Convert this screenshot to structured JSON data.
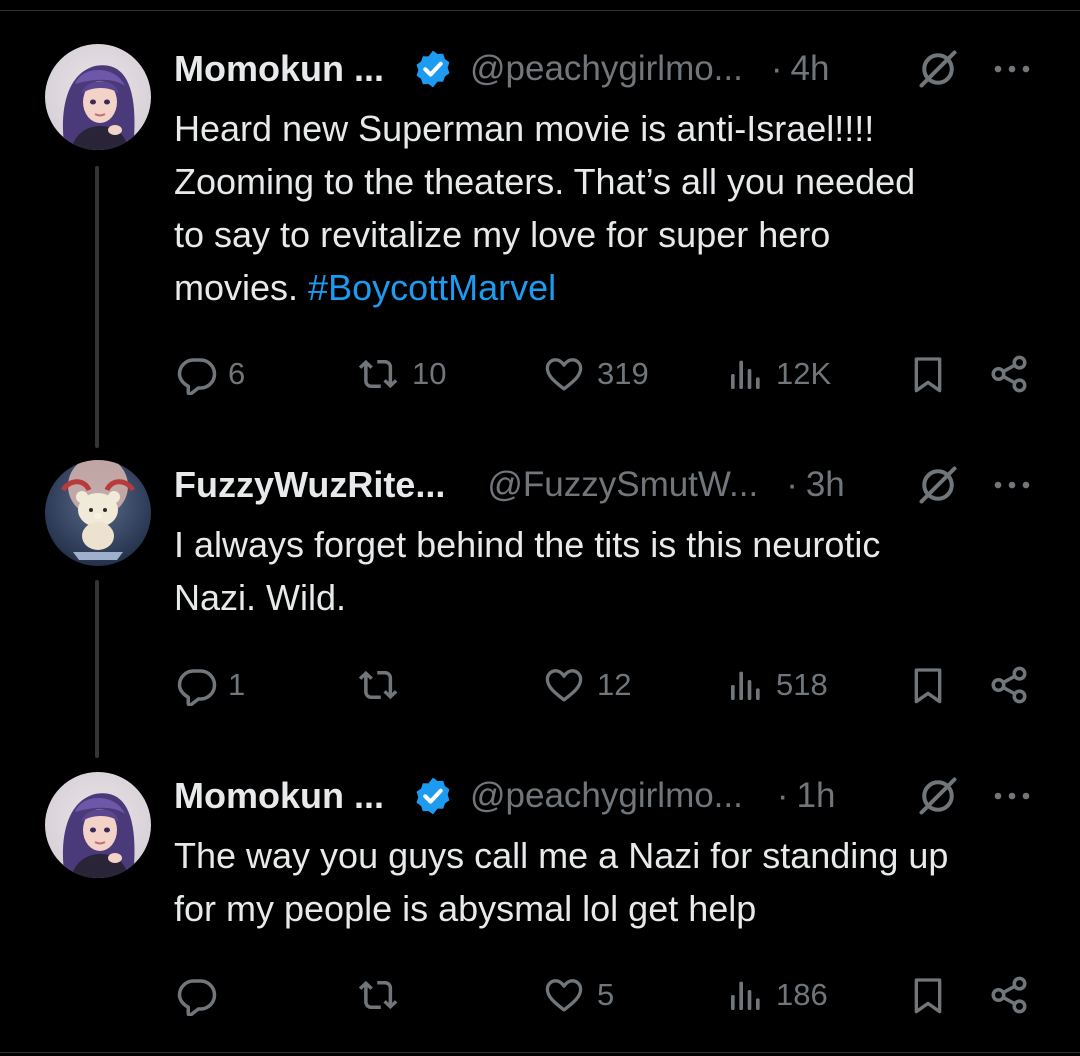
{
  "tweets": [
    {
      "name": "Momokun ...",
      "verified": true,
      "handle": "@peachygirlmo...",
      "separator": "·",
      "time": "4h",
      "text": "Heard new Superman movie is anti-Israel!!!!\nZooming to the theaters. That’s all you needed\nto say to revitalize my love for super hero\nmovies. ",
      "hashtag": "#BoycottMarvel",
      "stats": {
        "replies": "6",
        "reposts": "10",
        "likes": "319",
        "views": "12K"
      }
    },
    {
      "name": "FuzzyWuzRite...",
      "verified": false,
      "handle": "@FuzzySmutW...",
      "separator": "·",
      "time": "3h",
      "text": "I always forget behind the tits is this neurotic\nNazi. Wild.",
      "hashtag": "",
      "stats": {
        "replies": "1",
        "reposts": "",
        "likes": "12",
        "views": "518"
      }
    },
    {
      "name": "Momokun ...",
      "verified": true,
      "handle": "@peachygirlmo...",
      "separator": "·",
      "time": "1h",
      "text": "The way you guys call me a Nazi for standing up\nfor my people is abysmal lol get help",
      "hashtag": "",
      "stats": {
        "replies": "",
        "reposts": "",
        "likes": "5",
        "views": "186"
      }
    }
  ],
  "colors": {
    "background": "#000000",
    "text": "#e7e9ea",
    "secondary": "#71767b",
    "accent": "#1d9bf0"
  },
  "icons": [
    "verified-badge-icon",
    "grok-icon",
    "more-icon",
    "reply-icon",
    "repost-icon",
    "like-icon",
    "views-icon",
    "bookmark-icon",
    "share-icon"
  ]
}
